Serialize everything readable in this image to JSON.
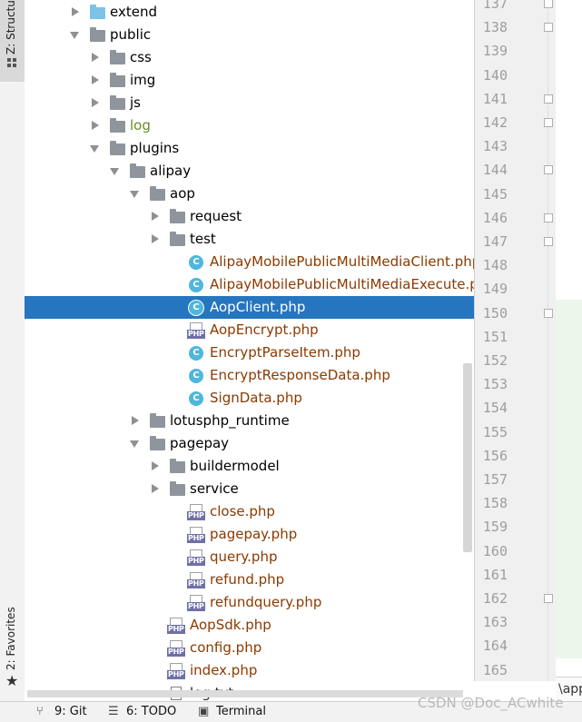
{
  "left_tabs": {
    "structure": "Z: Structure",
    "favorites": "2: Favorites"
  },
  "tree": [
    {
      "label": "extend",
      "kind": "folder-blue",
      "expand": "right",
      "depth": 0
    },
    {
      "label": "public",
      "kind": "folder",
      "expand": "down",
      "depth": 0
    },
    {
      "label": "css",
      "kind": "folder",
      "expand": "right",
      "depth": 1
    },
    {
      "label": "img",
      "kind": "folder",
      "expand": "right",
      "depth": 1
    },
    {
      "label": "js",
      "kind": "folder",
      "expand": "right",
      "depth": 1
    },
    {
      "label": "log",
      "kind": "folder",
      "expand": "right",
      "depth": 1,
      "style": "log"
    },
    {
      "label": "plugins",
      "kind": "folder",
      "expand": "down",
      "depth": 1
    },
    {
      "label": "alipay",
      "kind": "folder",
      "expand": "down",
      "depth": 2
    },
    {
      "label": "aop",
      "kind": "folder",
      "expand": "down",
      "depth": 3
    },
    {
      "label": "request",
      "kind": "folder",
      "expand": "right",
      "depth": 4
    },
    {
      "label": "test",
      "kind": "folder",
      "expand": "right",
      "depth": 4
    },
    {
      "label": "AlipayMobilePublicMultiMediaClient.php",
      "kind": "class",
      "depth": 5
    },
    {
      "label": "AlipayMobilePublicMultiMediaExecute.php",
      "kind": "class",
      "depth": 5
    },
    {
      "label": "AopClient.php",
      "kind": "class",
      "depth": 5,
      "selected": true
    },
    {
      "label": "AopEncrypt.php",
      "kind": "php",
      "depth": 5
    },
    {
      "label": "EncryptParseItem.php",
      "kind": "class",
      "depth": 5
    },
    {
      "label": "EncryptResponseData.php",
      "kind": "class",
      "depth": 5
    },
    {
      "label": "SignData.php",
      "kind": "class",
      "depth": 5
    },
    {
      "label": "lotusphp_runtime",
      "kind": "folder",
      "expand": "right",
      "depth": 3
    },
    {
      "label": "pagepay",
      "kind": "folder",
      "expand": "down",
      "depth": 3
    },
    {
      "label": "buildermodel",
      "kind": "folder",
      "expand": "right",
      "depth": 4
    },
    {
      "label": "service",
      "kind": "folder",
      "expand": "right",
      "depth": 4
    },
    {
      "label": "close.php",
      "kind": "php",
      "depth": 5
    },
    {
      "label": "pagepay.php",
      "kind": "php",
      "depth": 5
    },
    {
      "label": "query.php",
      "kind": "php",
      "depth": 5
    },
    {
      "label": "refund.php",
      "kind": "php",
      "depth": 5
    },
    {
      "label": "refundquery.php",
      "kind": "php",
      "depth": 5
    },
    {
      "label": "AopSdk.php",
      "kind": "php",
      "depth": 4
    },
    {
      "label": "config.php",
      "kind": "php",
      "depth": 4
    },
    {
      "label": "index.php",
      "kind": "php",
      "depth": 4
    },
    {
      "label": "log.txt",
      "kind": "txt",
      "depth": 4
    }
  ],
  "icons": {
    "class_letter": "C",
    "php_badge": "PHP"
  },
  "line_numbers": [
    "137",
    "138",
    "139",
    "140",
    "141",
    "142",
    "143",
    "144",
    "145",
    "146",
    "147",
    "148",
    "149",
    "150",
    "151",
    "152",
    "153",
    "154",
    "155",
    "156",
    "157",
    "158",
    "159",
    "160",
    "161",
    "162",
    "163",
    "164",
    "165"
  ],
  "fold_rows": [
    0,
    1,
    4,
    5,
    7,
    9,
    10,
    13,
    25
  ],
  "editor_breadcrumb": "\\app",
  "bottom_bar": [
    {
      "label": "9: Git",
      "icon": "git-branch-icon"
    },
    {
      "label": "6: TODO",
      "icon": "list-icon"
    },
    {
      "label": "Terminal",
      "icon": "terminal-icon"
    }
  ],
  "watermark": "CSDN @Doc_ACwhite",
  "colors": {
    "selection": "#2675bf",
    "php_file_text": "#8a3a00",
    "excluded_folder_text": "#6a8a2a",
    "class_icon": "#4fb6dc"
  }
}
